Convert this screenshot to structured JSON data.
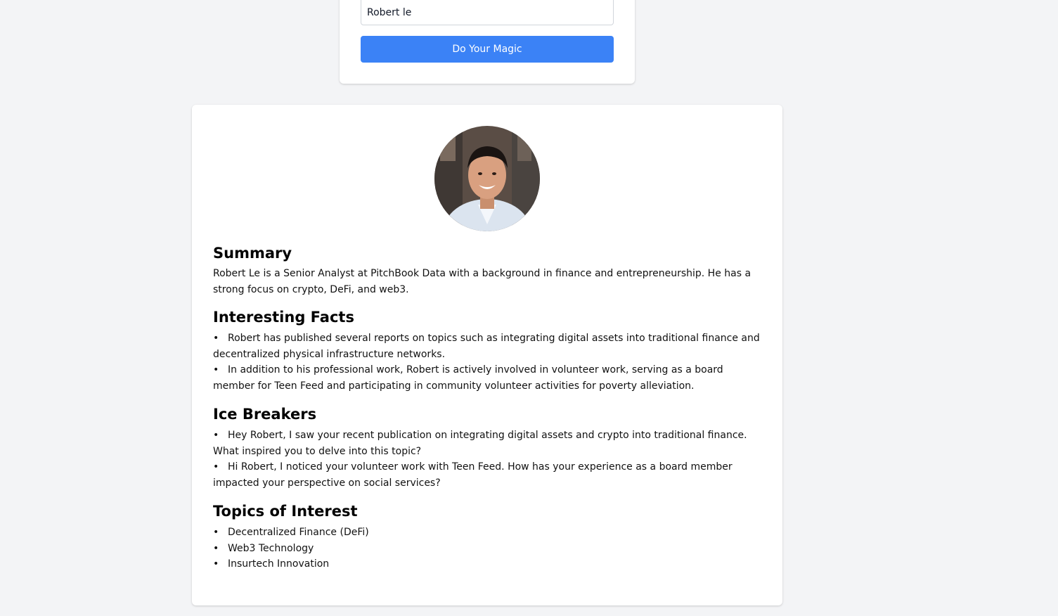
{
  "search": {
    "value": "Robert le",
    "button_label": "Do Your Magic"
  },
  "profile": {
    "avatar_icon": "person-portrait-icon",
    "summary_heading": "Summary",
    "summary_text": "Robert Le is a Senior Analyst at PitchBook Data with a background in finance and entrepreneurship. He has a strong focus on crypto, DeFi, and web3.",
    "facts_heading": "Interesting Facts",
    "facts": [
      "Robert has published several reports on topics such as integrating digital assets into traditional finance and decentralized physical infrastructure networks.",
      "In addition to his professional work, Robert is actively involved in volunteer work, serving as a board member for Teen Feed and participating in community volunteer activities for poverty alleviation."
    ],
    "ice_heading": "Ice Breakers",
    "ice_breakers": [
      "Hey Robert, I saw your recent publication on integrating digital assets and crypto into traditional finance. What inspired you to delve into this topic?",
      "Hi Robert, I noticed your volunteer work with Teen Feed. How has your experience as a board member impacted your perspective on social services?"
    ],
    "topics_heading": "Topics of Interest",
    "topics": [
      "Decentralized Finance (DeFi)",
      "Web3 Technology",
      "Insurtech Innovation"
    ]
  },
  "colors": {
    "background": "#f3f4f6",
    "card": "#ffffff",
    "accent": "#3b82f6"
  }
}
